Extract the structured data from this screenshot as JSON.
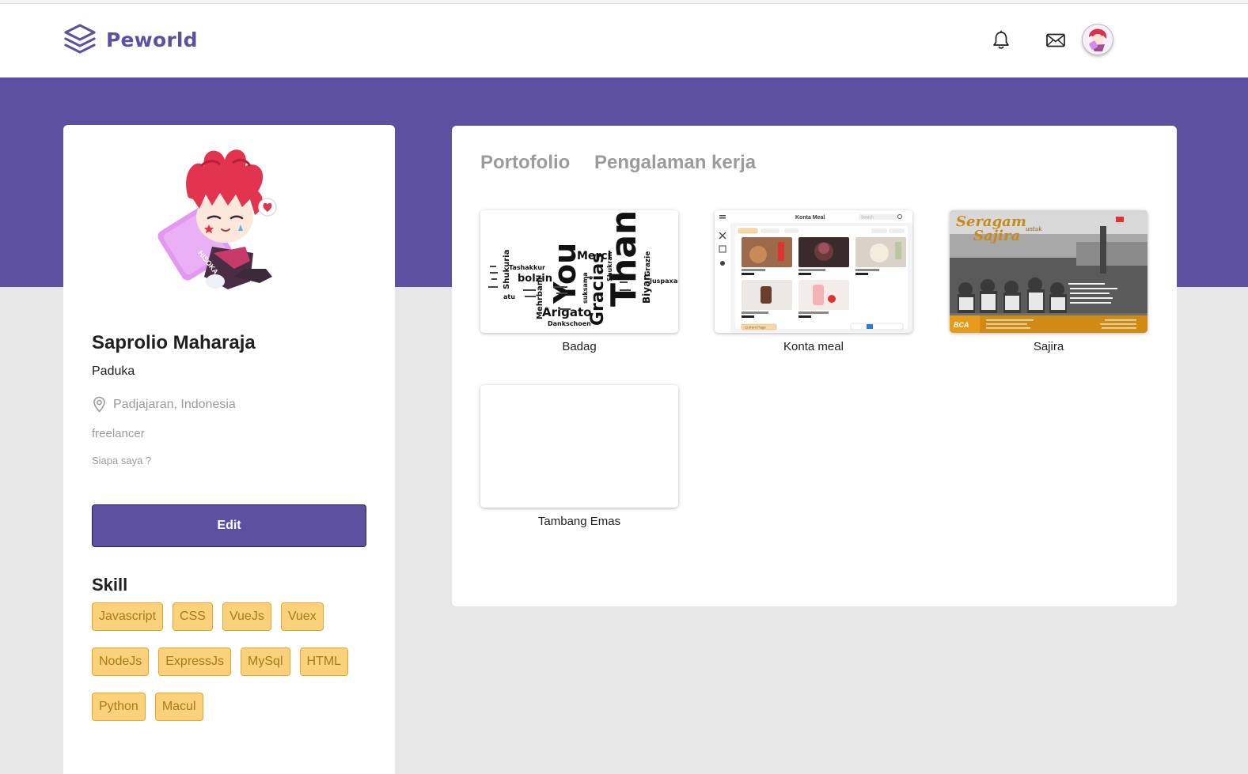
{
  "brand": {
    "name": "Peworld",
    "color": "#5e50a1"
  },
  "nav": {
    "icons": [
      "layers-logo-icon",
      "bell-icon",
      "mail-icon",
      "avatar"
    ]
  },
  "profile": {
    "name": "Saprolio Maharaja",
    "role": "Paduka",
    "location": "Padjajaran, Indonesia",
    "job_type": "freelancer",
    "about": "Siapa saya ?",
    "edit_label": "Edit",
    "skill_title": "Skill",
    "skills": [
      "Javascript",
      "CSS",
      "VueJs",
      "Vuex",
      "NodeJs",
      "ExpressJs",
      "MySql",
      "HTML",
      "Python",
      "Macul"
    ]
  },
  "tabs": [
    "Portofolio",
    "Pengalaman kerja"
  ],
  "portfolio": [
    {
      "title": "Badag",
      "thumb_words": [
        "Thank",
        "You",
        "Gracias",
        "Merci",
        "Arigato",
        "bolzin",
        "Shukuria",
        "Grazie",
        "Biyan",
        "Juspaxar",
        "Tashakkur",
        "Mehrbani",
        "Dankschoen",
        "atu",
        "Shukran",
        "suksama"
      ]
    },
    {
      "title": "Konta meal",
      "thumb_header": "Konta Meal",
      "thumb_search": "Search",
      "thumb_button": "Current Page"
    },
    {
      "title": "Sajira",
      "thumb_line1": "Seragam",
      "thumb_line2": "Sajira",
      "thumb_script": "untuk",
      "thumb_bank": "BCA"
    },
    {
      "title": "Tambang Emas"
    }
  ],
  "colors": {
    "accent": "#5e50a1",
    "background": "#e6e6e6",
    "skill_bg": "#fbd17b",
    "skill_border": "#e9a529",
    "skill_text": "#a57c1b",
    "muted_text": "#9b9b9b"
  }
}
